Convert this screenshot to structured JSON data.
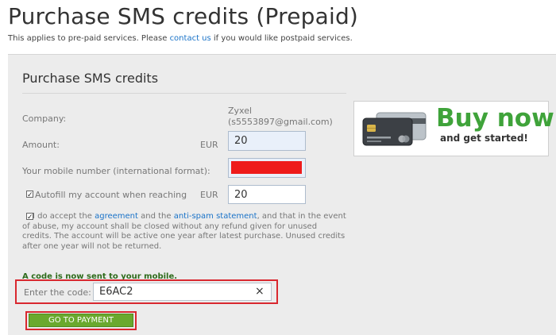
{
  "header": {
    "title": "Purchase SMS credits (Prepaid)",
    "subtitle_before": "This applies to pre-paid services. Please ",
    "subtitle_link": "contact us",
    "subtitle_after": " if you would like postpaid services."
  },
  "form": {
    "section_title": "Purchase SMS credits",
    "company_label": "Company:",
    "company_name": "Zyxel",
    "company_email": "(s5553897@gmail.com)",
    "amount_label": "Amount:",
    "amount_currency": "EUR",
    "amount_value": "20",
    "mobile_label": "Your mobile number (international format):",
    "autofill_label": "Autofill my account when reaching",
    "autofill_checked": "✓",
    "autofill_currency": "EUR",
    "autofill_value": "20",
    "terms_checked": "✓",
    "terms_p1": " I do accept the ",
    "terms_link1": "agreement",
    "terms_p2": " and the ",
    "terms_link2": "anti-spam statement",
    "terms_p3": ", and that in the event of abuse, my account shall be closed without any refund given for unused credits. The account will be active one year after latest purchase. Unused credits after one year will not be returned.",
    "notice": "A code is now sent to your mobile.",
    "code_label": "Enter the code:",
    "code_value": "E6AC2",
    "clear_glyph": "×",
    "pay_button": "GO TO PAYMENT"
  },
  "banner": {
    "headline": "Buy now",
    "tagline": "and get started!",
    "icon": "credit-cards-icon"
  },
  "colors": {
    "accent_green": "#6aa92e",
    "highlight_red": "#d9282f",
    "link_blue": "#1a73c8",
    "banner_green": "#3fa33a"
  }
}
